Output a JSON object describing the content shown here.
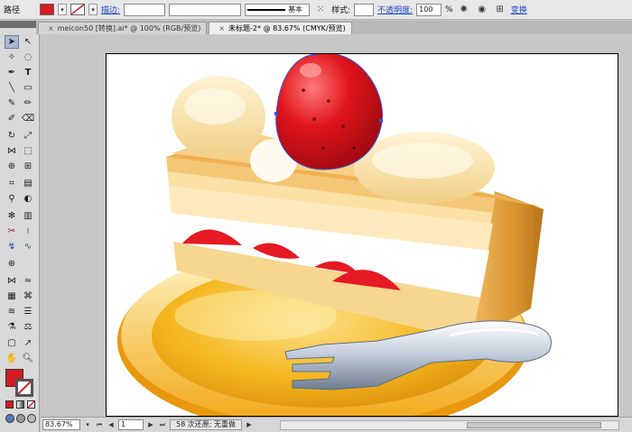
{
  "control_bar": {
    "selection_type": "路径",
    "fill_color": "#d41c24",
    "stroke_label": "描边:",
    "stroke_weight": "",
    "stroke_profile": "",
    "brush": "基本",
    "style_label": "样式:",
    "opacity_label": "不透明度:",
    "opacity_value": "100",
    "opacity_unit": "%",
    "transform_link": "变换"
  },
  "tabs": [
    {
      "label": "meicon50 [转换].ai* @ 100% (RGB/预览)"
    },
    {
      "label": "未标题-2* @ 83.67% (CMYK/预览)"
    }
  ],
  "status_bar": {
    "zoom": "83.67%",
    "page": "1",
    "history": "58 次还原; 无重做"
  },
  "colors": {
    "accent_fill": "#d41c24",
    "selection_path": "#3a4fd8"
  }
}
